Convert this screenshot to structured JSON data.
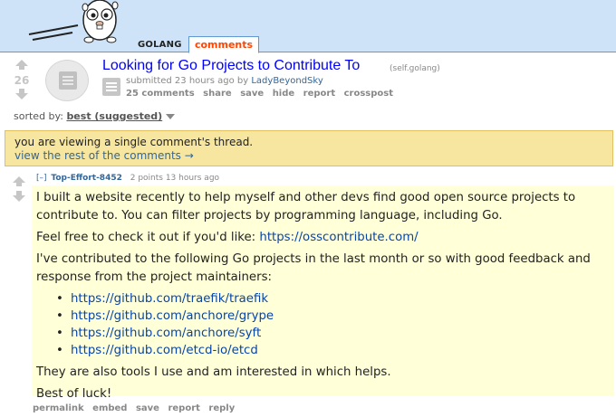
{
  "header": {
    "tabs": [
      {
        "label": "GOLANG",
        "selected": false
      },
      {
        "label": "comments",
        "selected": true
      }
    ]
  },
  "post": {
    "score": "26",
    "title": "Looking for Go Projects to Contribute To",
    "domain": "(self.golang)",
    "tagline_prefix": "submitted 23 hours ago by ",
    "author": "LadyBeyondSky",
    "actions": [
      "25 comments",
      "share",
      "save",
      "hide",
      "report",
      "crosspost"
    ]
  },
  "sort": {
    "label": "sorted by: ",
    "selected": "best (suggested)"
  },
  "notice": {
    "line1": "you are viewing a single comment's thread.",
    "line2": "view the rest of the comments →"
  },
  "comment": {
    "toggle": "[–]",
    "author": "Top-Effort-8452",
    "meta": "2 points 13 hours ago",
    "p1": "I built a website recently to help myself and other devs find good open source projects to contribute to. You can filter projects by programming language, including Go.",
    "p2_prefix": "Feel free to check it out if you'd like: ",
    "p2_link": "https://osscontribute.com/",
    "p3": "I've contributed to the following Go projects in the last month or so with good feedback and response from the project maintainers:",
    "links": [
      "https://github.com/traefik/traefik",
      "https://github.com/anchore/grype",
      "https://github.com/anchore/syft",
      "https://github.com/etcd-io/etcd"
    ],
    "p4": "They are also tools I use and am interested in which helps.",
    "p5": "Best of luck!",
    "buttons": [
      "permalink",
      "embed",
      "save",
      "report",
      "reply"
    ]
  },
  "colors": {
    "header_bg": "#cee3f8",
    "accent_orange": "#ff4500",
    "link_blue": "#0000ff",
    "notice_bg": "#f6e69f",
    "comment_bg": "#ffffd8"
  }
}
